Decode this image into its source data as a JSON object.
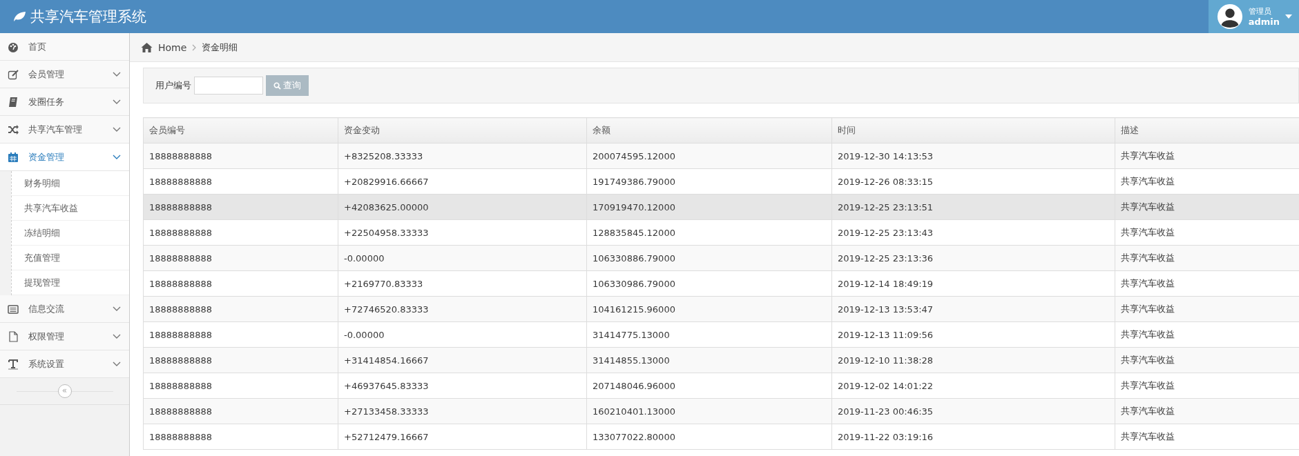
{
  "app": {
    "title": "共享汽车管理系统"
  },
  "user": {
    "role": "管理员",
    "name": "admin"
  },
  "sidebar": {
    "items": [
      {
        "label": "首页",
        "expandable": false,
        "selected": false
      },
      {
        "label": "会员管理",
        "expandable": true,
        "expanded": false,
        "selected": false
      },
      {
        "label": "发圈任务",
        "expandable": true,
        "expanded": false,
        "selected": false
      },
      {
        "label": "共享汽车管理",
        "expandable": true,
        "expanded": false,
        "selected": false
      },
      {
        "label": "资金管理",
        "expandable": true,
        "expanded": true,
        "selected": true,
        "children": [
          {
            "label": "财务明细"
          },
          {
            "label": "共享汽车收益"
          },
          {
            "label": "冻结明细"
          },
          {
            "label": "充值管理"
          },
          {
            "label": "提现管理"
          }
        ]
      },
      {
        "label": "信息交流",
        "expandable": true,
        "expanded": false,
        "selected": false
      },
      {
        "label": "权限管理",
        "expandable": true,
        "expanded": false,
        "selected": false
      },
      {
        "label": "系统设置",
        "expandable": true,
        "expanded": false,
        "selected": false
      }
    ],
    "collapse": "«"
  },
  "breadcrumb": [
    "Home",
    "资金明细"
  ],
  "search": {
    "label": "用户编号",
    "button": "查询"
  },
  "table": {
    "columns": [
      "会员编号",
      "资金变动",
      "余额",
      "时间",
      "描述"
    ],
    "rows": [
      {
        "highlighted": false,
        "cells": [
          "18888888888",
          "+8325208.33333",
          "200074595.12000",
          "2019-12-30 14:13:53",
          "共享汽车收益"
        ]
      },
      {
        "highlighted": false,
        "cells": [
          "18888888888",
          "+20829916.66667",
          "191749386.79000",
          "2019-12-26 08:33:15",
          "共享汽车收益"
        ]
      },
      {
        "highlighted": true,
        "cells": [
          "18888888888",
          "+42083625.00000",
          "170919470.12000",
          "2019-12-25 23:13:51",
          "共享汽车收益"
        ]
      },
      {
        "highlighted": false,
        "cells": [
          "18888888888",
          "+22504958.33333",
          "128835845.12000",
          "2019-12-25 23:13:43",
          "共享汽车收益"
        ]
      },
      {
        "highlighted": false,
        "cells": [
          "18888888888",
          "-0.00000",
          "106330886.79000",
          "2019-12-25 23:13:36",
          "共享汽车收益"
        ]
      },
      {
        "highlighted": false,
        "cells": [
          "18888888888",
          "+2169770.83333",
          "106330986.79000",
          "2019-12-14 18:49:19",
          "共享汽车收益"
        ]
      },
      {
        "highlighted": false,
        "cells": [
          "18888888888",
          "+72746520.83333",
          "104161215.96000",
          "2019-12-13 13:53:47",
          "共享汽车收益"
        ]
      },
      {
        "highlighted": false,
        "cells": [
          "18888888888",
          "-0.00000",
          "31414775.13000",
          "2019-12-13 11:09:56",
          "共享汽车收益"
        ]
      },
      {
        "highlighted": false,
        "cells": [
          "18888888888",
          "+31414854.16667",
          "31414855.13000",
          "2019-12-10 11:38:28",
          "共享汽车收益"
        ]
      },
      {
        "highlighted": false,
        "cells": [
          "18888888888",
          "+46937645.83333",
          "207148046.96000",
          "2019-12-02 14:01:22",
          "共享汽车收益"
        ]
      },
      {
        "highlighted": false,
        "cells": [
          "18888888888",
          "+27133458.33333",
          "160210401.13000",
          "2019-11-23 00:46:35",
          "共享汽车收益"
        ]
      },
      {
        "highlighted": false,
        "cells": [
          "18888888888",
          "+52712479.16667",
          "133077022.80000",
          "2019-11-22 03:19:16",
          "共享汽车收益"
        ]
      }
    ]
  }
}
